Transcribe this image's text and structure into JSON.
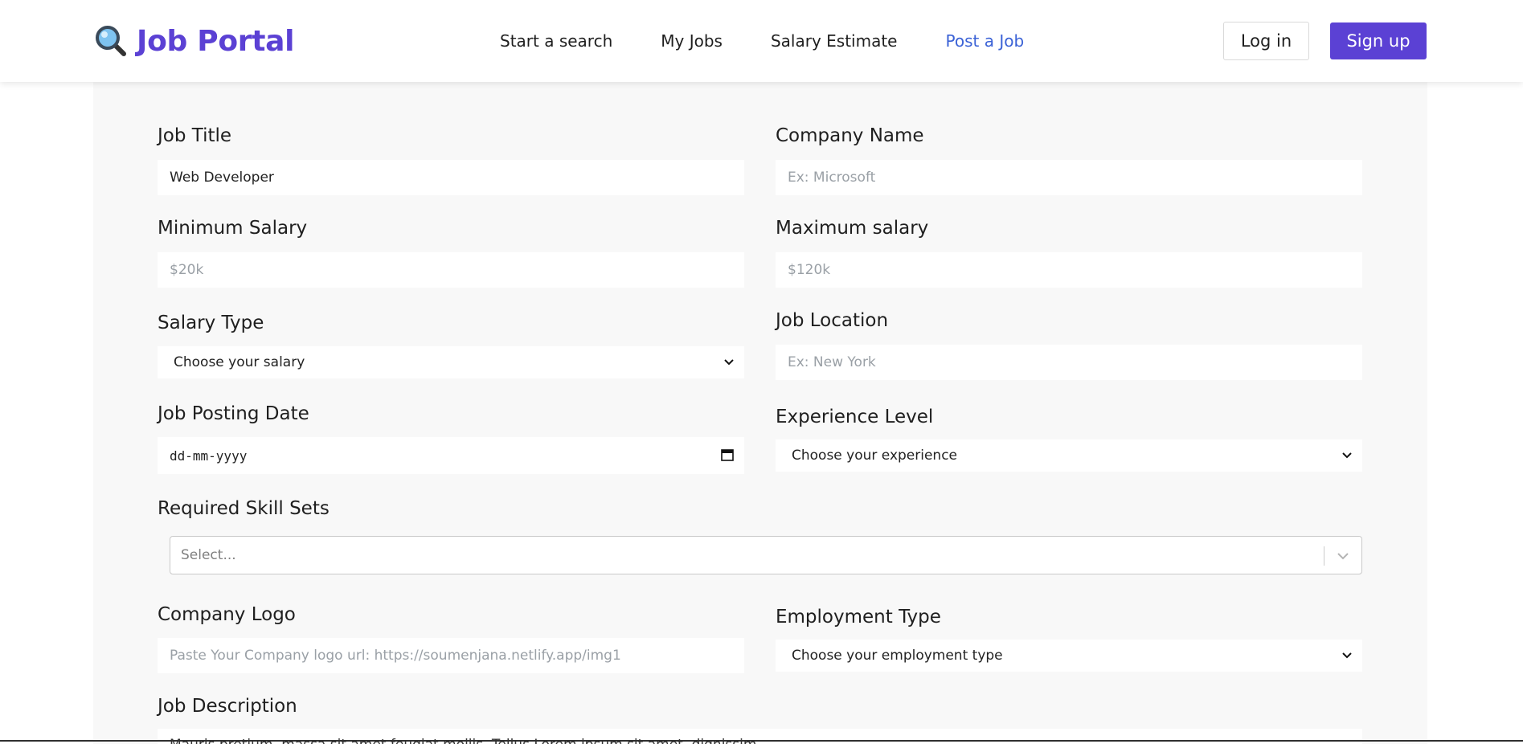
{
  "header": {
    "logo_text": "Job Portal",
    "logo_icon": "magnifier-icon",
    "nav": [
      {
        "label": "Start a search"
      },
      {
        "label": "My Jobs"
      },
      {
        "label": "Salary Estimate"
      },
      {
        "label": "Post a Job",
        "active": true
      }
    ],
    "login_label": "Log in",
    "signup_label": "Sign up",
    "brand_color": "#5b41d4",
    "active_link_color": "#3b62d6"
  },
  "form": {
    "job_title": {
      "label": "Job Title",
      "value": "Web Developer"
    },
    "company_name": {
      "label": "Company Name",
      "placeholder": "Ex: Microsoft"
    },
    "min_salary": {
      "label": "Minimum Salary",
      "placeholder": "$20k"
    },
    "max_salary": {
      "label": "Maximum salary",
      "placeholder": "$120k"
    },
    "salary_type": {
      "label": "Salary Type",
      "selected": "Choose your salary"
    },
    "job_location": {
      "label": "Job Location",
      "placeholder": "Ex: New York"
    },
    "posting_date": {
      "label": "Job Posting Date",
      "placeholder": "dd-mm-yyyy"
    },
    "experience_level": {
      "label": "Experience Level",
      "selected": "Choose your experience"
    },
    "skills": {
      "label": "Required Skill Sets",
      "placeholder": "Select..."
    },
    "company_logo": {
      "label": "Company Logo",
      "placeholder": "Paste Your Company logo url: https://soumenjana.netlify.app/img1"
    },
    "employment_type": {
      "label": "Employment Type",
      "selected": "Choose your employment type"
    },
    "job_description": {
      "label": "Job Description",
      "value": "Mauris pretium, massa sit amet feugiat mollis, Tellus Lorem ipsum sit amet, dignissim"
    }
  }
}
